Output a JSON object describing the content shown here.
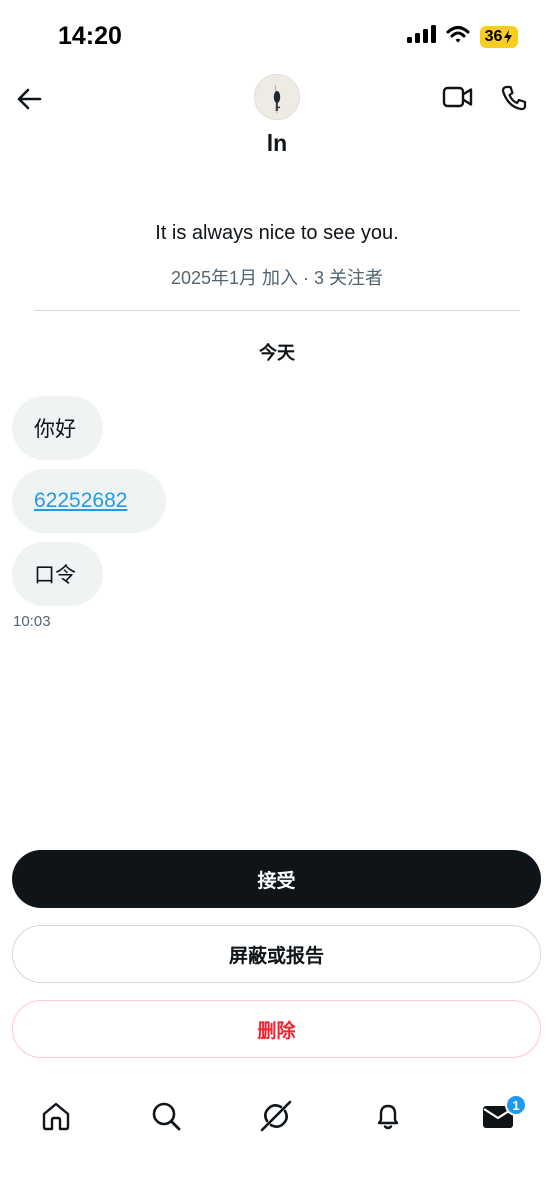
{
  "status_bar": {
    "time": "14:20",
    "battery": "36"
  },
  "header": {
    "name": "ln"
  },
  "profile": {
    "bio": "It is always nice to see you.",
    "meta": "2025年1月 加入 · 3 关注者"
  },
  "conversation": {
    "date_separator": "今天",
    "messages": [
      {
        "text": "你好"
      },
      {
        "text": "62252682"
      },
      {
        "text": "口令"
      }
    ],
    "last_timestamp": "10:03"
  },
  "actions": {
    "accept_label": "接受",
    "block_report_label": "屏蔽或报告",
    "delete_label": "删除"
  },
  "nav": {
    "messages_badge": "1"
  },
  "colors": {
    "accent": "#1d9bf0",
    "danger": "#f4212e",
    "primary_button": "#0f1419",
    "bubble": "#eff3f4",
    "battery": "#f7ce1f"
  },
  "icons": [
    "signal-icon",
    "wifi-icon",
    "battery-icon",
    "back-arrow-icon",
    "video-call-icon",
    "phone-icon",
    "home-icon",
    "search-icon",
    "grok-icon",
    "bell-icon",
    "mail-icon"
  ]
}
